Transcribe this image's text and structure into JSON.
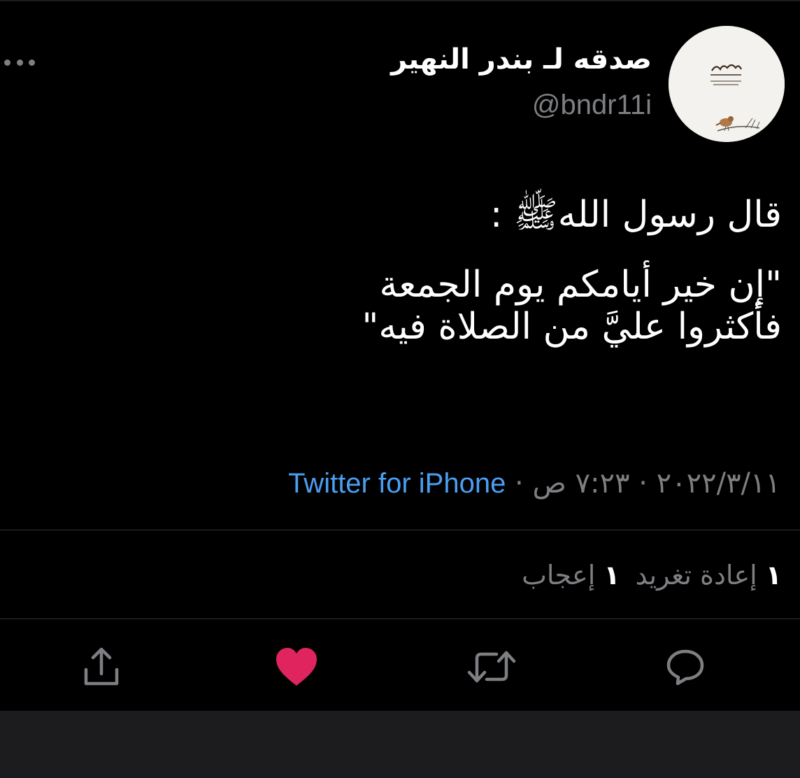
{
  "author": {
    "display_name": "صدقه لـ بندر النهير",
    "handle": "@bndr11i"
  },
  "tweet": {
    "line1": "قال رسول اللهﷺ  :",
    "line2": "\"إن خير أيامكم يوم الجمعة",
    "line3": "فأكثروا عليَّ من الصلاة فيه\""
  },
  "meta": {
    "date": "٢٠٢٢/٣/١١",
    "separator": "·",
    "time": "٧:٢٣ ص",
    "source": "Twitter for iPhone"
  },
  "stats": {
    "retweets_count": "١",
    "retweets_label": "إعادة تغريد",
    "likes_count": "١",
    "likes_label": "إعجاب"
  },
  "colors": {
    "background": "#000000",
    "link": "#4b9ef1",
    "muted": "#7d7f82",
    "like": "#e0245e",
    "bottom_bar": "#1c1c1e"
  },
  "icons": {
    "more": "more-horizontal-icon",
    "reply": "reply-bubble-icon",
    "retweet": "retweet-icon",
    "like": "heart-filled-icon",
    "share": "share-upload-icon"
  }
}
